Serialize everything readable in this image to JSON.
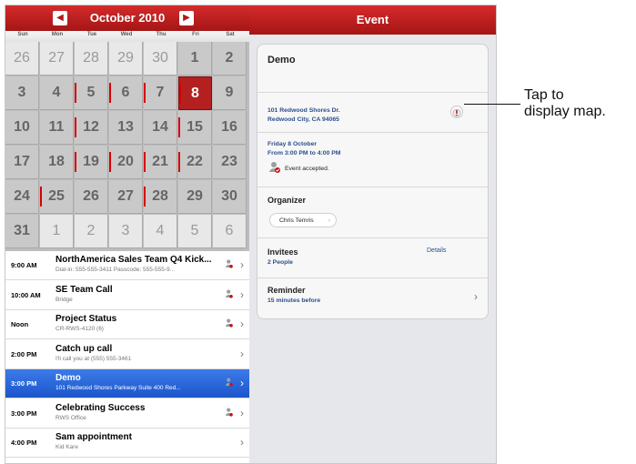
{
  "calendar": {
    "month_title": "October 2010",
    "days_of_week": [
      "Sun",
      "Mon",
      "Tue",
      "Wed",
      "Thu",
      "Fri",
      "Sat"
    ],
    "weeks": [
      [
        {
          "d": "26",
          "other": true
        },
        {
          "d": "27",
          "other": true
        },
        {
          "d": "28",
          "other": true
        },
        {
          "d": "29",
          "other": true
        },
        {
          "d": "30",
          "other": true
        },
        {
          "d": "1"
        },
        {
          "d": "2"
        }
      ],
      [
        {
          "d": "3"
        },
        {
          "d": "4"
        },
        {
          "d": "5"
        },
        {
          "d": "6"
        },
        {
          "d": "7"
        },
        {
          "d": "8",
          "today": true
        },
        {
          "d": "9"
        }
      ],
      [
        {
          "d": "10"
        },
        {
          "d": "11"
        },
        {
          "d": "12"
        },
        {
          "d": "13"
        },
        {
          "d": "14"
        },
        {
          "d": "15"
        },
        {
          "d": "16"
        }
      ],
      [
        {
          "d": "17"
        },
        {
          "d": "18"
        },
        {
          "d": "19"
        },
        {
          "d": "20"
        },
        {
          "d": "21"
        },
        {
          "d": "22"
        },
        {
          "d": "23"
        }
      ],
      [
        {
          "d": "24"
        },
        {
          "d": "25"
        },
        {
          "d": "26"
        },
        {
          "d": "27"
        },
        {
          "d": "28"
        },
        {
          "d": "29"
        },
        {
          "d": "30"
        }
      ],
      [
        {
          "d": "31"
        },
        {
          "d": "1",
          "other": true
        },
        {
          "d": "2",
          "other": true
        },
        {
          "d": "3",
          "other": true
        },
        {
          "d": "4",
          "other": true
        },
        {
          "d": "5",
          "other": true
        },
        {
          "d": "6",
          "other": true
        }
      ]
    ]
  },
  "events": [
    {
      "time": "9:00 AM",
      "title": "NorthAmerica Sales Team Q4 Kick...",
      "sub": "Dial-in: 555-555-3411 Passcode: 555-555-9...",
      "selected": false
    },
    {
      "time": "10:00 AM",
      "title": "SE Team Call",
      "sub": "Bridge",
      "selected": false
    },
    {
      "time": "Noon",
      "title": "Project Status",
      "sub": "CR-RWS-4120 (6)",
      "selected": false
    },
    {
      "time": "2:00 PM",
      "title": "Catch up call",
      "sub": "I'll call you at (555) 555-3461",
      "selected": false
    },
    {
      "time": "3:00 PM",
      "title": "Demo",
      "sub": "101 Redwood Shores Parkway Suite 400 Red...",
      "selected": true
    },
    {
      "time": "3:00 PM",
      "title": "Celebrating Success",
      "sub": "RWS Office",
      "selected": false
    },
    {
      "time": "4:00 PM",
      "title": "Sam appointment",
      "sub": "Kid Kare",
      "selected": false
    }
  ],
  "detail": {
    "header": "Event",
    "name": "Demo",
    "address_line1": "101 Redwood Shores Dr.",
    "address_line2": "Redwood City, CA 94065",
    "date": "Friday 8 October",
    "time_range": "From 3:00 PM to 4:00 PM",
    "status": "Event accepted.",
    "organizer_label": "Organizer",
    "organizer_name": "Chris Temris",
    "invitees_label": "Invitees",
    "invitees_count": "2 People",
    "details_link": "Details",
    "reminder_label": "Reminder",
    "reminder_value": "15 minutes before"
  },
  "callout": {
    "line1": "Tap to",
    "line2": "display map."
  },
  "colors": {
    "accent_red": "#b41f1f",
    "selection_blue": "#1b56cb",
    "link_blue": "#2a4e8c"
  }
}
